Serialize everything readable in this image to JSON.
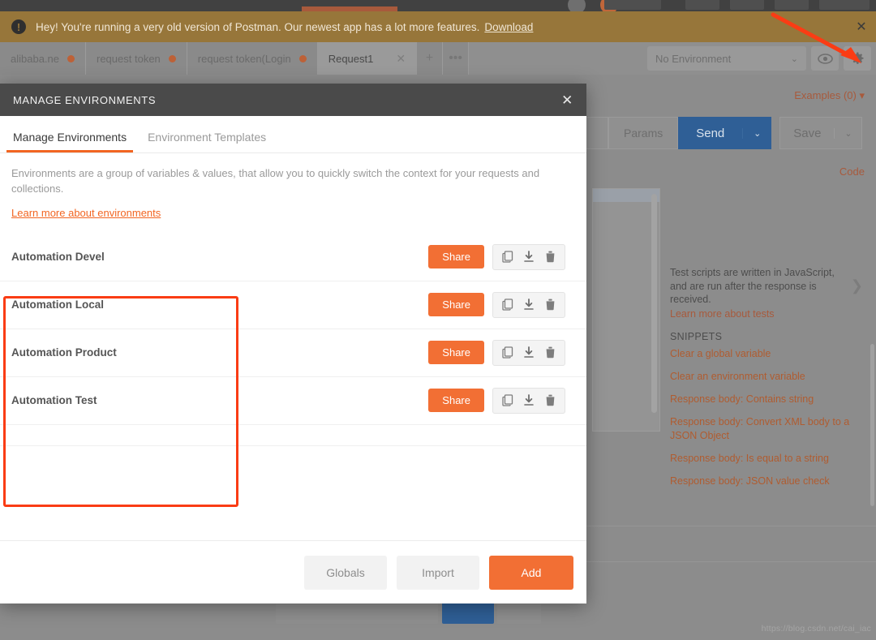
{
  "banner": {
    "icon": "alert-circle-icon",
    "text": "Hey! You're running a very old version of Postman. Our newest app has a lot more features.",
    "link": "Download",
    "close": "✕",
    "bg_color": "#97763a"
  },
  "tabs": {
    "items": [
      {
        "label": "alibaba.ne",
        "dirty": true,
        "active": false
      },
      {
        "label": "request token",
        "dirty": true,
        "active": false
      },
      {
        "label": "request token(Login",
        "dirty": true,
        "active": false
      },
      {
        "label": "Request1",
        "dirty": false,
        "active": true
      }
    ],
    "new_tab": "+",
    "more": "•••",
    "close_glyph": "✕"
  },
  "workspace_bar": {
    "environment_selected": "No Environment",
    "chevron": "⌄",
    "eye_icon": "eye-icon",
    "gear_icon": "gear-icon"
  },
  "request_area": {
    "examples": "Examples (0)",
    "examples_caret": "▾",
    "params": "Params",
    "send": "Send",
    "send_caret": "⌄",
    "save": "Save",
    "save_caret": "⌄",
    "code": "Code"
  },
  "snippets_panel": {
    "intro": "Test scripts are written in JavaScript, and are run after the response is received.",
    "learn_more": "Learn more about tests",
    "heading": "SNIPPETS",
    "chevron": "❯",
    "items": [
      "Clear a global variable",
      "Clear an environment variable",
      "Response body: Contains string",
      "Response body: Convert XML body to a JSON Object",
      "Response body: Is equal to a string",
      "Response body: JSON value check"
    ]
  },
  "modal": {
    "title": "MANAGE ENVIRONMENTS",
    "close": "✕",
    "tabs": [
      {
        "label": "Manage Environments",
        "active": true
      },
      {
        "label": "Environment Templates",
        "active": false
      }
    ],
    "description": "Environments are a group of variables & values, that allow you to quickly switch the context for your requests and collections.",
    "learn_link": "Learn more about environments",
    "environments": [
      {
        "name": "Automation Devel",
        "share": "Share"
      },
      {
        "name": "Automation Local",
        "share": "Share"
      },
      {
        "name": "Automation Product",
        "share": "Share"
      },
      {
        "name": "Automation Test",
        "share": "Share"
      }
    ],
    "row_icons": {
      "duplicate": "duplicate-icon",
      "download": "download-icon",
      "delete": "trash-icon"
    },
    "footer": {
      "globals": "Globals",
      "import": "Import",
      "add": "Add"
    },
    "accent_color": "#f26f34",
    "header_bg": "#4a4a4a"
  },
  "annotations": {
    "highlight_color": "#fa3c14",
    "arrow_color": "#fa3c14",
    "arrow_target": "gear-icon"
  },
  "watermark": "https://blog.csdn.net/cai_iac"
}
